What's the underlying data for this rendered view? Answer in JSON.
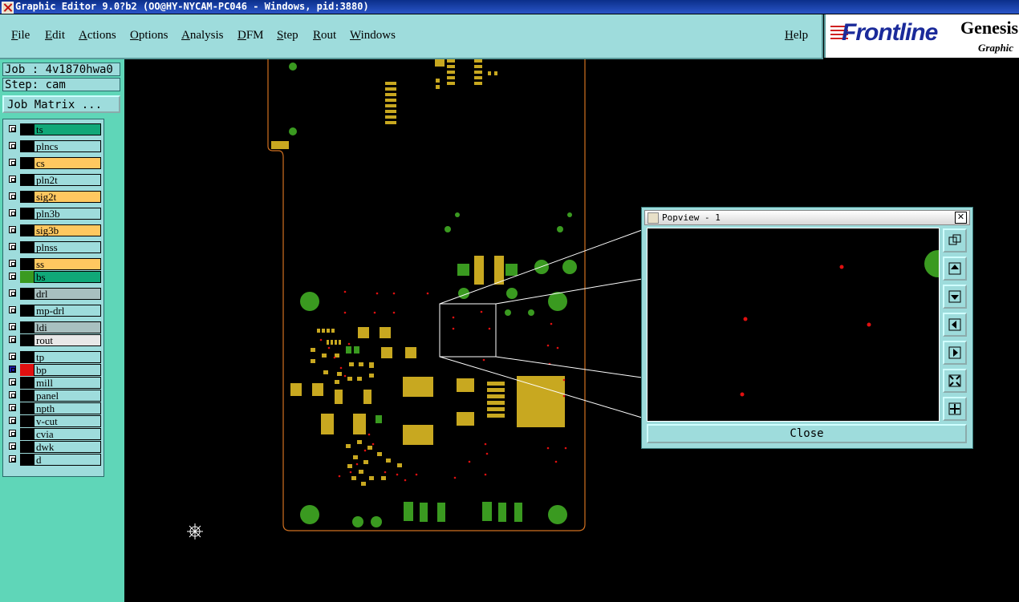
{
  "title": "Graphic Editor 9.0?b2 (OO@HY-NYCAM-PC046 - Windows, pid:3880)",
  "menu": [
    {
      "label": "File"
    },
    {
      "label": "Edit"
    },
    {
      "label": "Actions"
    },
    {
      "label": "Options"
    },
    {
      "label": "Analysis"
    },
    {
      "label": "DFM"
    },
    {
      "label": "Step"
    },
    {
      "label": "Rout"
    },
    {
      "label": "Windows"
    },
    {
      "label": "Help"
    }
  ],
  "logo": {
    "brand": "Frontline",
    "product": "Genesis",
    "subtitle": "Graphic"
  },
  "job": {
    "label": "Job : 4v1870hwa0",
    "step": "Step: cam",
    "matrix_button": "Job Matrix ..."
  },
  "layers": [
    {
      "name": "ts",
      "color": "#10a878"
    },
    {
      "name": "plncs",
      "color": "#9edcdc"
    },
    {
      "name": "cs",
      "color": "#ffc860"
    },
    {
      "name": "pln2t",
      "color": "#9edcdc"
    },
    {
      "name": "sig2t",
      "color": "#ffc860"
    },
    {
      "name": "pln3b",
      "color": "#9edcdc"
    },
    {
      "name": "sig3b",
      "color": "#ffc860"
    },
    {
      "name": "plnss",
      "color": "#9edcdc"
    },
    {
      "name": "ss",
      "color": "#ffc860"
    },
    {
      "name": "bs",
      "color": "#10a878"
    },
    {
      "name": "drl",
      "color": "#a8c0c0"
    },
    {
      "name": "mp-drl",
      "color": "#9edcdc"
    },
    {
      "name": "ldi",
      "color": "#a8c0c0"
    },
    {
      "name": "rout",
      "color": "#e8e8e8"
    },
    {
      "name": "tp",
      "color": "#9edcdc"
    },
    {
      "name": "bp",
      "color": "#9edcdc"
    },
    {
      "name": "mill",
      "color": "#9edcdc"
    },
    {
      "name": "panel",
      "color": "#9edcdc"
    },
    {
      "name": "npth",
      "color": "#9edcdc"
    },
    {
      "name": "v-cut",
      "color": "#9edcdc"
    },
    {
      "name": "cvia",
      "color": "#9edcdc"
    },
    {
      "name": "dwk",
      "color": "#9edcdc"
    },
    {
      "name": "d",
      "color": "#9edcdc"
    }
  ],
  "popview": {
    "title": "Popview - 1",
    "close_label": "Close"
  },
  "colors": {
    "pad_yellow": "#c8a820",
    "pad_green": "#3a9a20",
    "via_red": "#e01010",
    "outline": "#d07020"
  }
}
